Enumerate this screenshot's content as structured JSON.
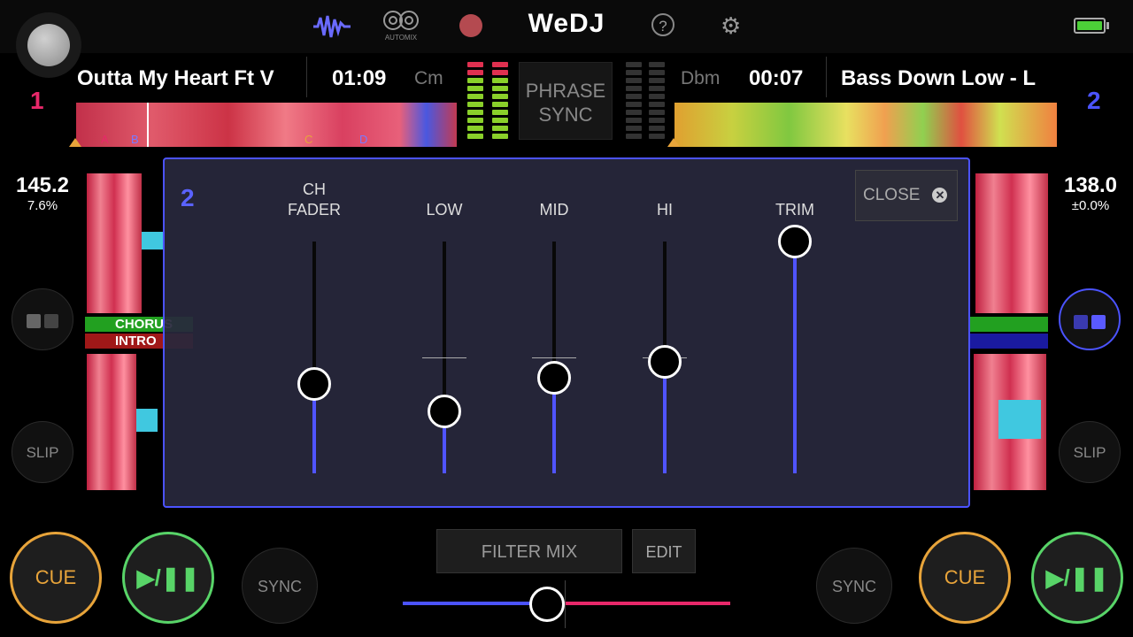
{
  "app": {
    "title": "WeDJ",
    "automix_label": "AUTOMIX",
    "help_glyph": "?",
    "settings_glyph": "⚙"
  },
  "colors": {
    "accent_blue": "#4b53ff",
    "deck1_pink": "#e8286a",
    "cue_orange": "#e8a43a",
    "play_green": "#58d468"
  },
  "deck1": {
    "number": "1",
    "title": "Outta My Heart Ft V",
    "time": "01:09",
    "key": "Cm",
    "bpm": "145.2",
    "pitch": "7.6%",
    "cue_label": "CUE",
    "play_label": "▶/❚❚",
    "sync_label": "SYNC",
    "slip_label": "SLIP",
    "markers": [
      "A",
      "B",
      "C",
      "D"
    ],
    "phrase_tags": [
      "CHORUS",
      "INTRO"
    ]
  },
  "deck2": {
    "number": "2",
    "title": "Bass Down Low - L",
    "time": "00:07",
    "key": "Dbm",
    "bpm": "138.0",
    "pitch": "±0.0%",
    "cue_label": "CUE",
    "play_label": "▶/❚❚",
    "sync_label": "SYNC",
    "slip_label": "SLIP"
  },
  "phrase_sync": {
    "line1": "PHRASE",
    "line2": "SYNC"
  },
  "panel": {
    "deck_number": "2",
    "close_label": "CLOSE",
    "close_glyph": "✕",
    "faders": [
      {
        "label": "CH\nFADER",
        "level": 0.37
      },
      {
        "label": "LOW",
        "level": 0.25
      },
      {
        "label": "MID",
        "level": 0.4
      },
      {
        "label": "HI",
        "level": 0.47
      },
      {
        "label": "TRIM",
        "level": 1.0
      }
    ]
  },
  "mixer": {
    "filter_mix_label": "FILTER MIX",
    "edit_label": "EDIT",
    "crossfader_level": 0.44
  }
}
